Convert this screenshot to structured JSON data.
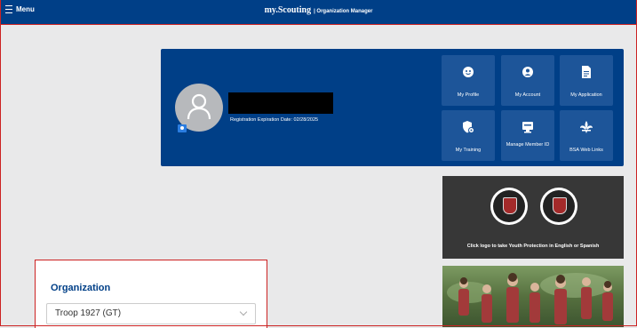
{
  "topbar": {
    "menu_label": "Menu",
    "brand": "my.Scouting",
    "subtitle": "| Organization Manager"
  },
  "profile": {
    "registration_text": "Registration Expiration Date: 02/28/2025"
  },
  "tiles": [
    {
      "label": "My Profile",
      "icon": "smile-face-icon"
    },
    {
      "label": "My Account",
      "icon": "user-circle-icon"
    },
    {
      "label": "My Application",
      "icon": "document-icon"
    },
    {
      "label": "My Training",
      "icon": "shield-gear-icon"
    },
    {
      "label": "Manage Member ID",
      "icon": "id-card-icon"
    },
    {
      "label": "BSA Web Links",
      "icon": "fleur-de-lis-icon"
    }
  ],
  "youth_protection": {
    "caption": "Click logo to take Youth Protection in English or Spanish"
  },
  "organization": {
    "label": "Organization",
    "selected": "Troop 1927 (GT)"
  },
  "colors": {
    "brand_blue": "#003f87",
    "tile_blue": "#1d5599",
    "accent_red": "#cc2222"
  }
}
